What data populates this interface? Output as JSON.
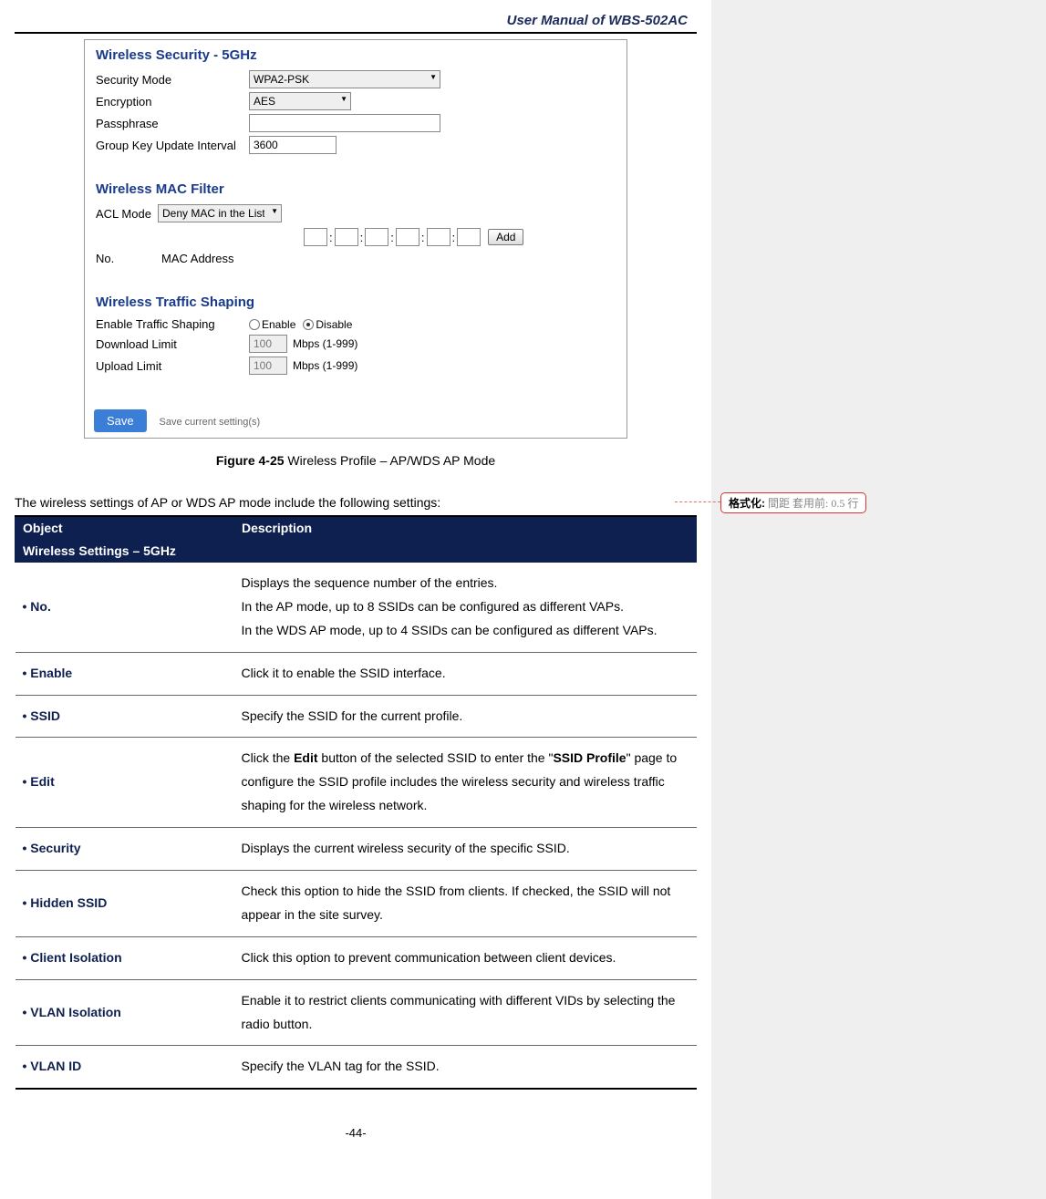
{
  "doc_title": "User  Manual  of  WBS-502AC",
  "page_number": "-44-",
  "screenshot": {
    "sec_security": "Wireless Security - 5GHz",
    "security_mode_label": "Security Mode",
    "security_mode_value": "WPA2-PSK",
    "encryption_label": "Encryption",
    "encryption_value": "AES",
    "passphrase_label": "Passphrase",
    "passphrase_value": "",
    "gkui_label": "Group Key Update Interval",
    "gkui_value": "3600",
    "sec_mac": "Wireless MAC Filter",
    "acl_label": "ACL Mode",
    "acl_value": "Deny MAC in the List",
    "add_btn": "Add",
    "mac_hdr_no": "No.",
    "mac_hdr_addr": "MAC Address",
    "sec_traffic": "Wireless Traffic Shaping",
    "ets_label": "Enable Traffic Shaping",
    "ets_enable": "Enable",
    "ets_disable": "Disable",
    "dl_label": "Download Limit",
    "dl_value": "100",
    "dl_suffix": "Mbps (1-999)",
    "ul_label": "Upload Limit",
    "ul_value": "100",
    "ul_suffix": "Mbps (1-999)",
    "save_btn": "Save",
    "save_note": "Save current setting(s)"
  },
  "figure": {
    "num": "Figure 4-25",
    "caption": " Wireless Profile – AP/WDS AP Mode"
  },
  "intro_text": "The wireless settings of AP or WDS AP mode include the following settings:",
  "table": {
    "h_object": "Object",
    "h_desc": "Description",
    "sub_header": "Wireless Settings – 5GHz",
    "rows": [
      {
        "obj": "No.",
        "desc": "Displays the sequence number of the entries.\nIn the AP mode, up to 8 SSIDs can be configured as different VAPs.\nIn the WDS AP mode, up to 4 SSIDs can be configured as different VAPs."
      },
      {
        "obj": "Enable",
        "desc": "Click it to enable the SSID interface."
      },
      {
        "obj": "SSID",
        "desc": "Specify the SSID for the current profile."
      },
      {
        "obj": "Edit",
        "desc_html": "Click the <b>Edit</b> button of the selected SSID to enter the \"<b>SSID Profile</b>\" page to configure the SSID profile includes the wireless security and wireless traffic shaping for the wireless network."
      },
      {
        "obj": "Security",
        "desc": "Displays the current wireless security of the specific SSID."
      },
      {
        "obj": "Hidden SSID",
        "desc": "Check this option to hide the SSID from clients. If checked, the SSID will not appear in the site survey."
      },
      {
        "obj": "Client Isolation",
        "desc": "Click this option to prevent communication between client devices."
      },
      {
        "obj": "VLAN Isolation",
        "desc": "Enable it to restrict clients communicating with different VIDs by selecting the radio button."
      },
      {
        "obj": "VLAN ID",
        "desc": "Specify the VLAN tag for the SSID."
      }
    ]
  },
  "comment": {
    "bold": "格式化:",
    "text": " 間距 套用前:  0.5 行"
  }
}
